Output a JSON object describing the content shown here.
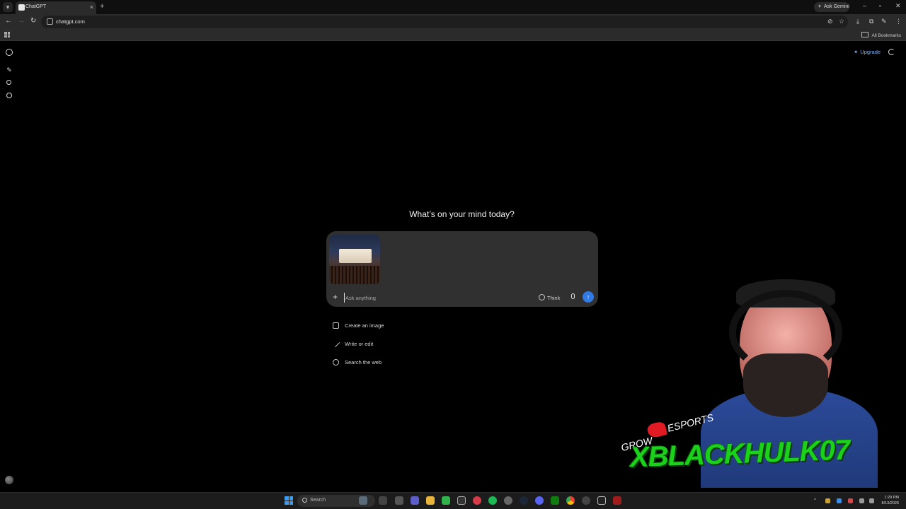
{
  "browser": {
    "tab_title": "ChatGPT",
    "new_tab_symbol": "+",
    "tab_close_symbol": "×",
    "ask_gemini": "Ask Gemini",
    "url": "chatgpt.com",
    "bookmarks_label": "All Bookmarks"
  },
  "app": {
    "upgrade_label": "Upgrade",
    "headline": "What’s on your mind today?",
    "composer": {
      "placeholder": "Ask anything",
      "think_label": "Think",
      "attachment": "image-thumbnail"
    },
    "suggestions": [
      {
        "label": "Create an image",
        "icon": "image-icon"
      },
      {
        "label": "Write or edit",
        "icon": "pencil-icon"
      },
      {
        "label": "Search the web",
        "icon": "globe-icon"
      }
    ]
  },
  "overlay": {
    "grow": "GROW",
    "esports": "ESPORTS",
    "channel_name": "XBLACKHULK07"
  },
  "taskbar": {
    "search_label": "Search",
    "time": "1:29 PM",
    "date": "8/13/2026"
  },
  "colors": {
    "accent": "#2f7ae5",
    "upgrade": "#7fb5ff",
    "brand_green": "#1cd11c"
  }
}
